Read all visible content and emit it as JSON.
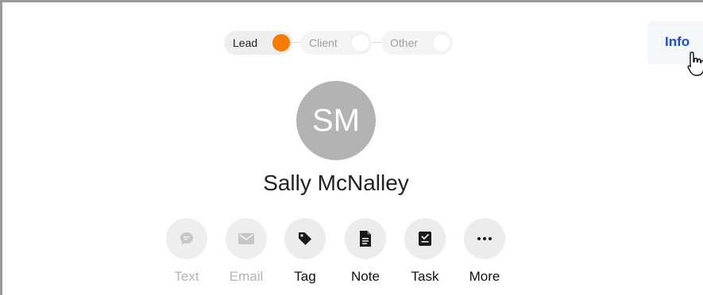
{
  "pipeline": {
    "stages": [
      {
        "label": "Lead",
        "active": true
      },
      {
        "label": "Client",
        "active": false
      },
      {
        "label": "Other",
        "active": false
      }
    ]
  },
  "header": {
    "info_label": "Info"
  },
  "contact": {
    "initials": "SM",
    "name": "Sally McNalley"
  },
  "actions": [
    {
      "label": "Text",
      "icon": "chat-bubble-icon",
      "enabled": false
    },
    {
      "label": "Email",
      "icon": "envelope-icon",
      "enabled": false
    },
    {
      "label": "Tag",
      "icon": "tag-icon",
      "enabled": true
    },
    {
      "label": "Note",
      "icon": "document-icon",
      "enabled": true
    },
    {
      "label": "Task",
      "icon": "checklist-icon",
      "enabled": true
    },
    {
      "label": "More",
      "icon": "ellipsis-icon",
      "enabled": true
    }
  ],
  "colors": {
    "stage_active": "#f57c00",
    "info_link": "#1a4fd6",
    "avatar_bg": "#b3b3b3"
  }
}
